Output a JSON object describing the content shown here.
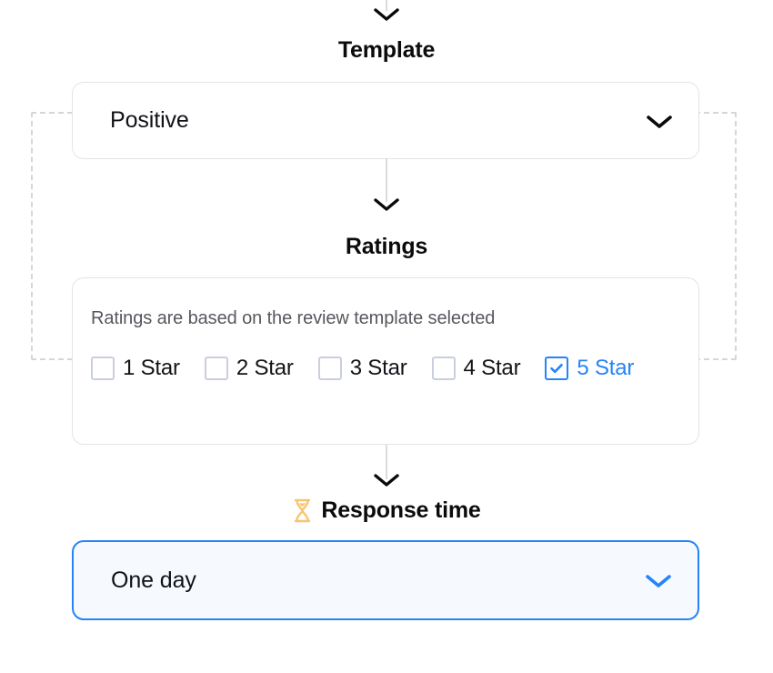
{
  "flow": {
    "arrows": [
      "chevron-down",
      "chevron-down",
      "chevron-down"
    ]
  },
  "template_section": {
    "heading": "Template",
    "select": {
      "value": "Positive",
      "chevron": "chevron-down-icon"
    }
  },
  "ratings_section": {
    "heading": "Ratings",
    "note": "Ratings are based on the review template selected",
    "options": [
      {
        "label": "1 Star",
        "checked": false
      },
      {
        "label": "2 Star",
        "checked": false
      },
      {
        "label": "3 Star",
        "checked": false
      },
      {
        "label": "4 Star",
        "checked": false
      },
      {
        "label": "5 Star",
        "checked": true
      }
    ]
  },
  "response_section": {
    "heading": "Response time",
    "icon": "hourglass-icon",
    "select": {
      "value": "One day",
      "chevron": "chevron-down-icon"
    }
  },
  "colors": {
    "accent_blue": "#2584f7",
    "accent_blue_bg": "#f6f9fe",
    "card_border": "#e3e4e6",
    "checkbox_border": "#c9cfdd",
    "note_text": "#56585e",
    "connector": "#d9dbde",
    "dashed_border": "#d4d6d9",
    "hourglass_amber": "#f8c471"
  }
}
